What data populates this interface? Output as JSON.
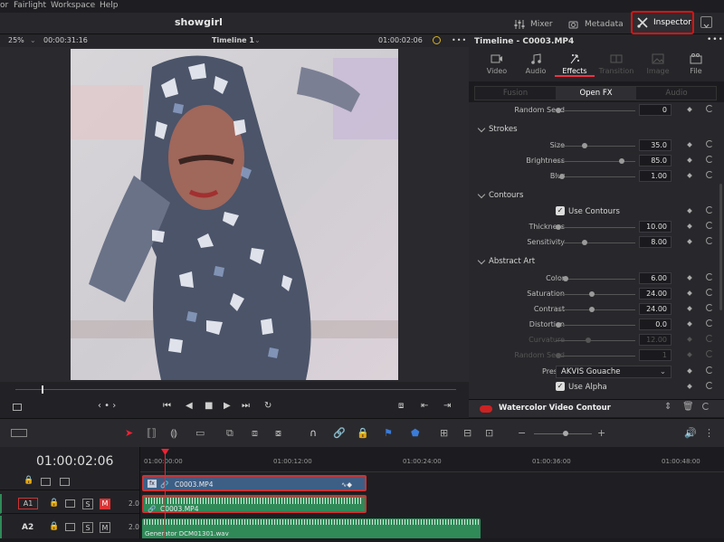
{
  "menubar": {
    "items": [
      "or",
      "Fairlight",
      "Workspace",
      "Help"
    ]
  },
  "titlebar": {
    "project": "showgirl",
    "mixer": "Mixer",
    "metadata": "Metadata",
    "inspector": "Inspector"
  },
  "viewer": {
    "zoom": "25%",
    "duration": "00:00:31:16",
    "timeline_name": "Timeline 1",
    "timecode": "01:00:02:06"
  },
  "inspector": {
    "title": "Timeline - C0003.MP4",
    "tabs": [
      {
        "label": "Video"
      },
      {
        "label": "Audio"
      },
      {
        "label": "Effects"
      },
      {
        "label": "Transition"
      },
      {
        "label": "Image"
      },
      {
        "label": "File"
      }
    ],
    "subtabs": [
      "Fusion",
      "Open FX",
      "Audio"
    ],
    "params": {
      "random_seed_top": {
        "label": "Random Seed",
        "value": "0",
        "level": 0
      },
      "strokes": "Strokes",
      "size": {
        "label": "Size",
        "value": "35.0",
        "level": 0.35
      },
      "brightness": {
        "label": "Brightness",
        "value": "85.0",
        "level": 0.85
      },
      "blur": {
        "label": "Blur",
        "value": "1.00",
        "level": 0.05
      },
      "contours": "Contours",
      "use_contours": "Use Contours",
      "thickness": {
        "label": "Thickness",
        "value": "10.00",
        "level": 0.0
      },
      "sensitivity": {
        "label": "Sensitivity",
        "value": "8.00",
        "level": 0.35
      },
      "abstract_art": "Abstract Art",
      "color": {
        "label": "Color",
        "value": "6.00",
        "level": 0.1
      },
      "saturation": {
        "label": "Saturation",
        "value": "24.00",
        "level": 0.45
      },
      "contrast": {
        "label": "Contrast",
        "value": "24.00",
        "level": 0.45
      },
      "distortion": {
        "label": "Distortion",
        "value": "0.0",
        "level": 0.0
      },
      "curvature": {
        "label": "Curvature",
        "value": "12.00",
        "level": 0.4
      },
      "random_seed": {
        "label": "Random Seed",
        "value": "1",
        "level": 0.0
      },
      "preset_label": "Preset",
      "preset_value": "AKVIS Gouache",
      "use_alpha": "Use Alpha"
    },
    "effect_name": "Watercolor Video Contour"
  },
  "timeline": {
    "timecode": "01:00:02:06",
    "ruler": [
      "01:00:00:00",
      "01:00:12:00",
      "01:00:24:00",
      "01:00:36:00",
      "01:00:48:00"
    ],
    "tracks": {
      "a1": "A1",
      "a2": "A2",
      "a1_level": "2.0",
      "a2_level": "2.0",
      "solo": "S",
      "mute": "M"
    },
    "clips": {
      "video": "C0003.MP4",
      "audio": "C0003.MP4",
      "audio2": "Generator DCM01301.wav"
    }
  },
  "colors": {
    "accent_red": "#dd2222",
    "video_clip": "#3d5f86",
    "audio_clip": "#2f8a58"
  }
}
